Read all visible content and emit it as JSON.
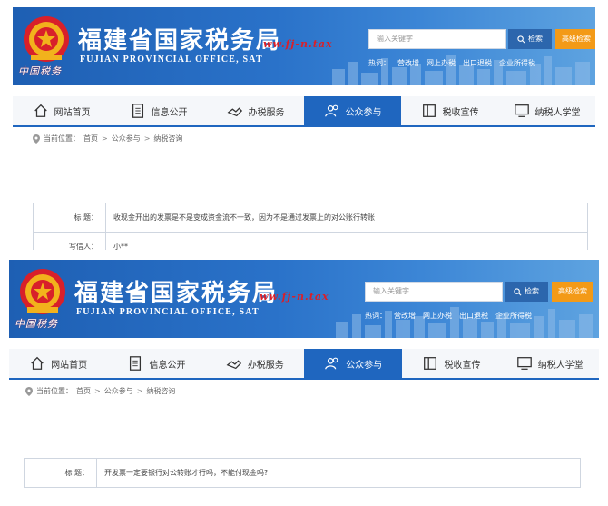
{
  "header": {
    "title": "福建省国家税务局",
    "subtitle": "FUJIAN PROVINCIAL OFFICE, SAT",
    "stamp": "ww.fj-n.tax",
    "script_logo": "中国税务"
  },
  "search": {
    "placeholder": "输入关键字",
    "search_label": "检索",
    "advanced_label": "高级检索",
    "hot_label": "热词：",
    "hot_words": [
      "营改增",
      "网上办税",
      "出口退税",
      "企业所得税"
    ]
  },
  "nav": {
    "items": [
      {
        "label": "网站首页",
        "icon": "home-icon"
      },
      {
        "label": "信息公开",
        "icon": "document-icon"
      },
      {
        "label": "办税服务",
        "icon": "handshake-icon"
      },
      {
        "label": "公众参与",
        "icon": "people-icon",
        "active": true
      },
      {
        "label": "税收宣传",
        "icon": "book-icon"
      },
      {
        "label": "纳税人学堂",
        "icon": "monitor-icon"
      }
    ]
  },
  "breadcrumb": {
    "prefix": "当前位置：",
    "home": "首页",
    "section": "公众参与",
    "page": "纳税咨询"
  },
  "screenshot1": {
    "rows": [
      {
        "label": "标  题：",
        "value": "收现金开出的发票是不是变成资金流不一致，因为不是通过发票上的对公账行转账"
      },
      {
        "label": "写信人：",
        "value": "小**"
      }
    ]
  },
  "screenshot2": {
    "rows": [
      {
        "label": "标  题：",
        "value": "开发票一定要银行对公转账才行吗，不能付现金吗?"
      }
    ]
  },
  "colors": {
    "header_blue": "#1e5fb3",
    "nav_active": "#1f66bf",
    "advanced_orange": "#f39a17"
  }
}
